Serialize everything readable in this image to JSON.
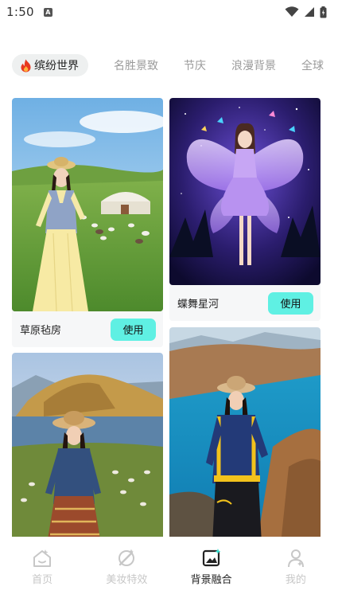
{
  "status_bar": {
    "time": "1:50",
    "notification_letter": "A"
  },
  "tabs": [
    {
      "label": "缤纷世界",
      "active": true
    },
    {
      "label": "名胜景致",
      "active": false
    },
    {
      "label": "节庆",
      "active": false
    },
    {
      "label": "浪漫背景",
      "active": false
    },
    {
      "label": "全球",
      "active": false
    }
  ],
  "cards": [
    {
      "title": "草原毡房",
      "button": "使用",
      "image": "grassland-yurt-photo"
    },
    {
      "title": "蝶舞星河",
      "button": "使用",
      "image": "butterfly-galaxy-photo"
    },
    {
      "title": "",
      "button": "",
      "image": "lakeside-mountain-photo"
    },
    {
      "title": "",
      "button": "",
      "image": "turquoise-lake-hiker-photo"
    }
  ],
  "bottom_nav": [
    {
      "label": "首页",
      "icon": "home-icon",
      "active": false
    },
    {
      "label": "美妆特效",
      "icon": "beauty-wand-icon",
      "active": false
    },
    {
      "label": "背景融合",
      "icon": "image-blend-icon",
      "active": true
    },
    {
      "label": "我的",
      "icon": "profile-icon",
      "active": false
    }
  ],
  "colors": {
    "accent": "#5ff0e3",
    "active_icon_accent": "#35e0d0",
    "inactive": "#c7c7c7"
  }
}
